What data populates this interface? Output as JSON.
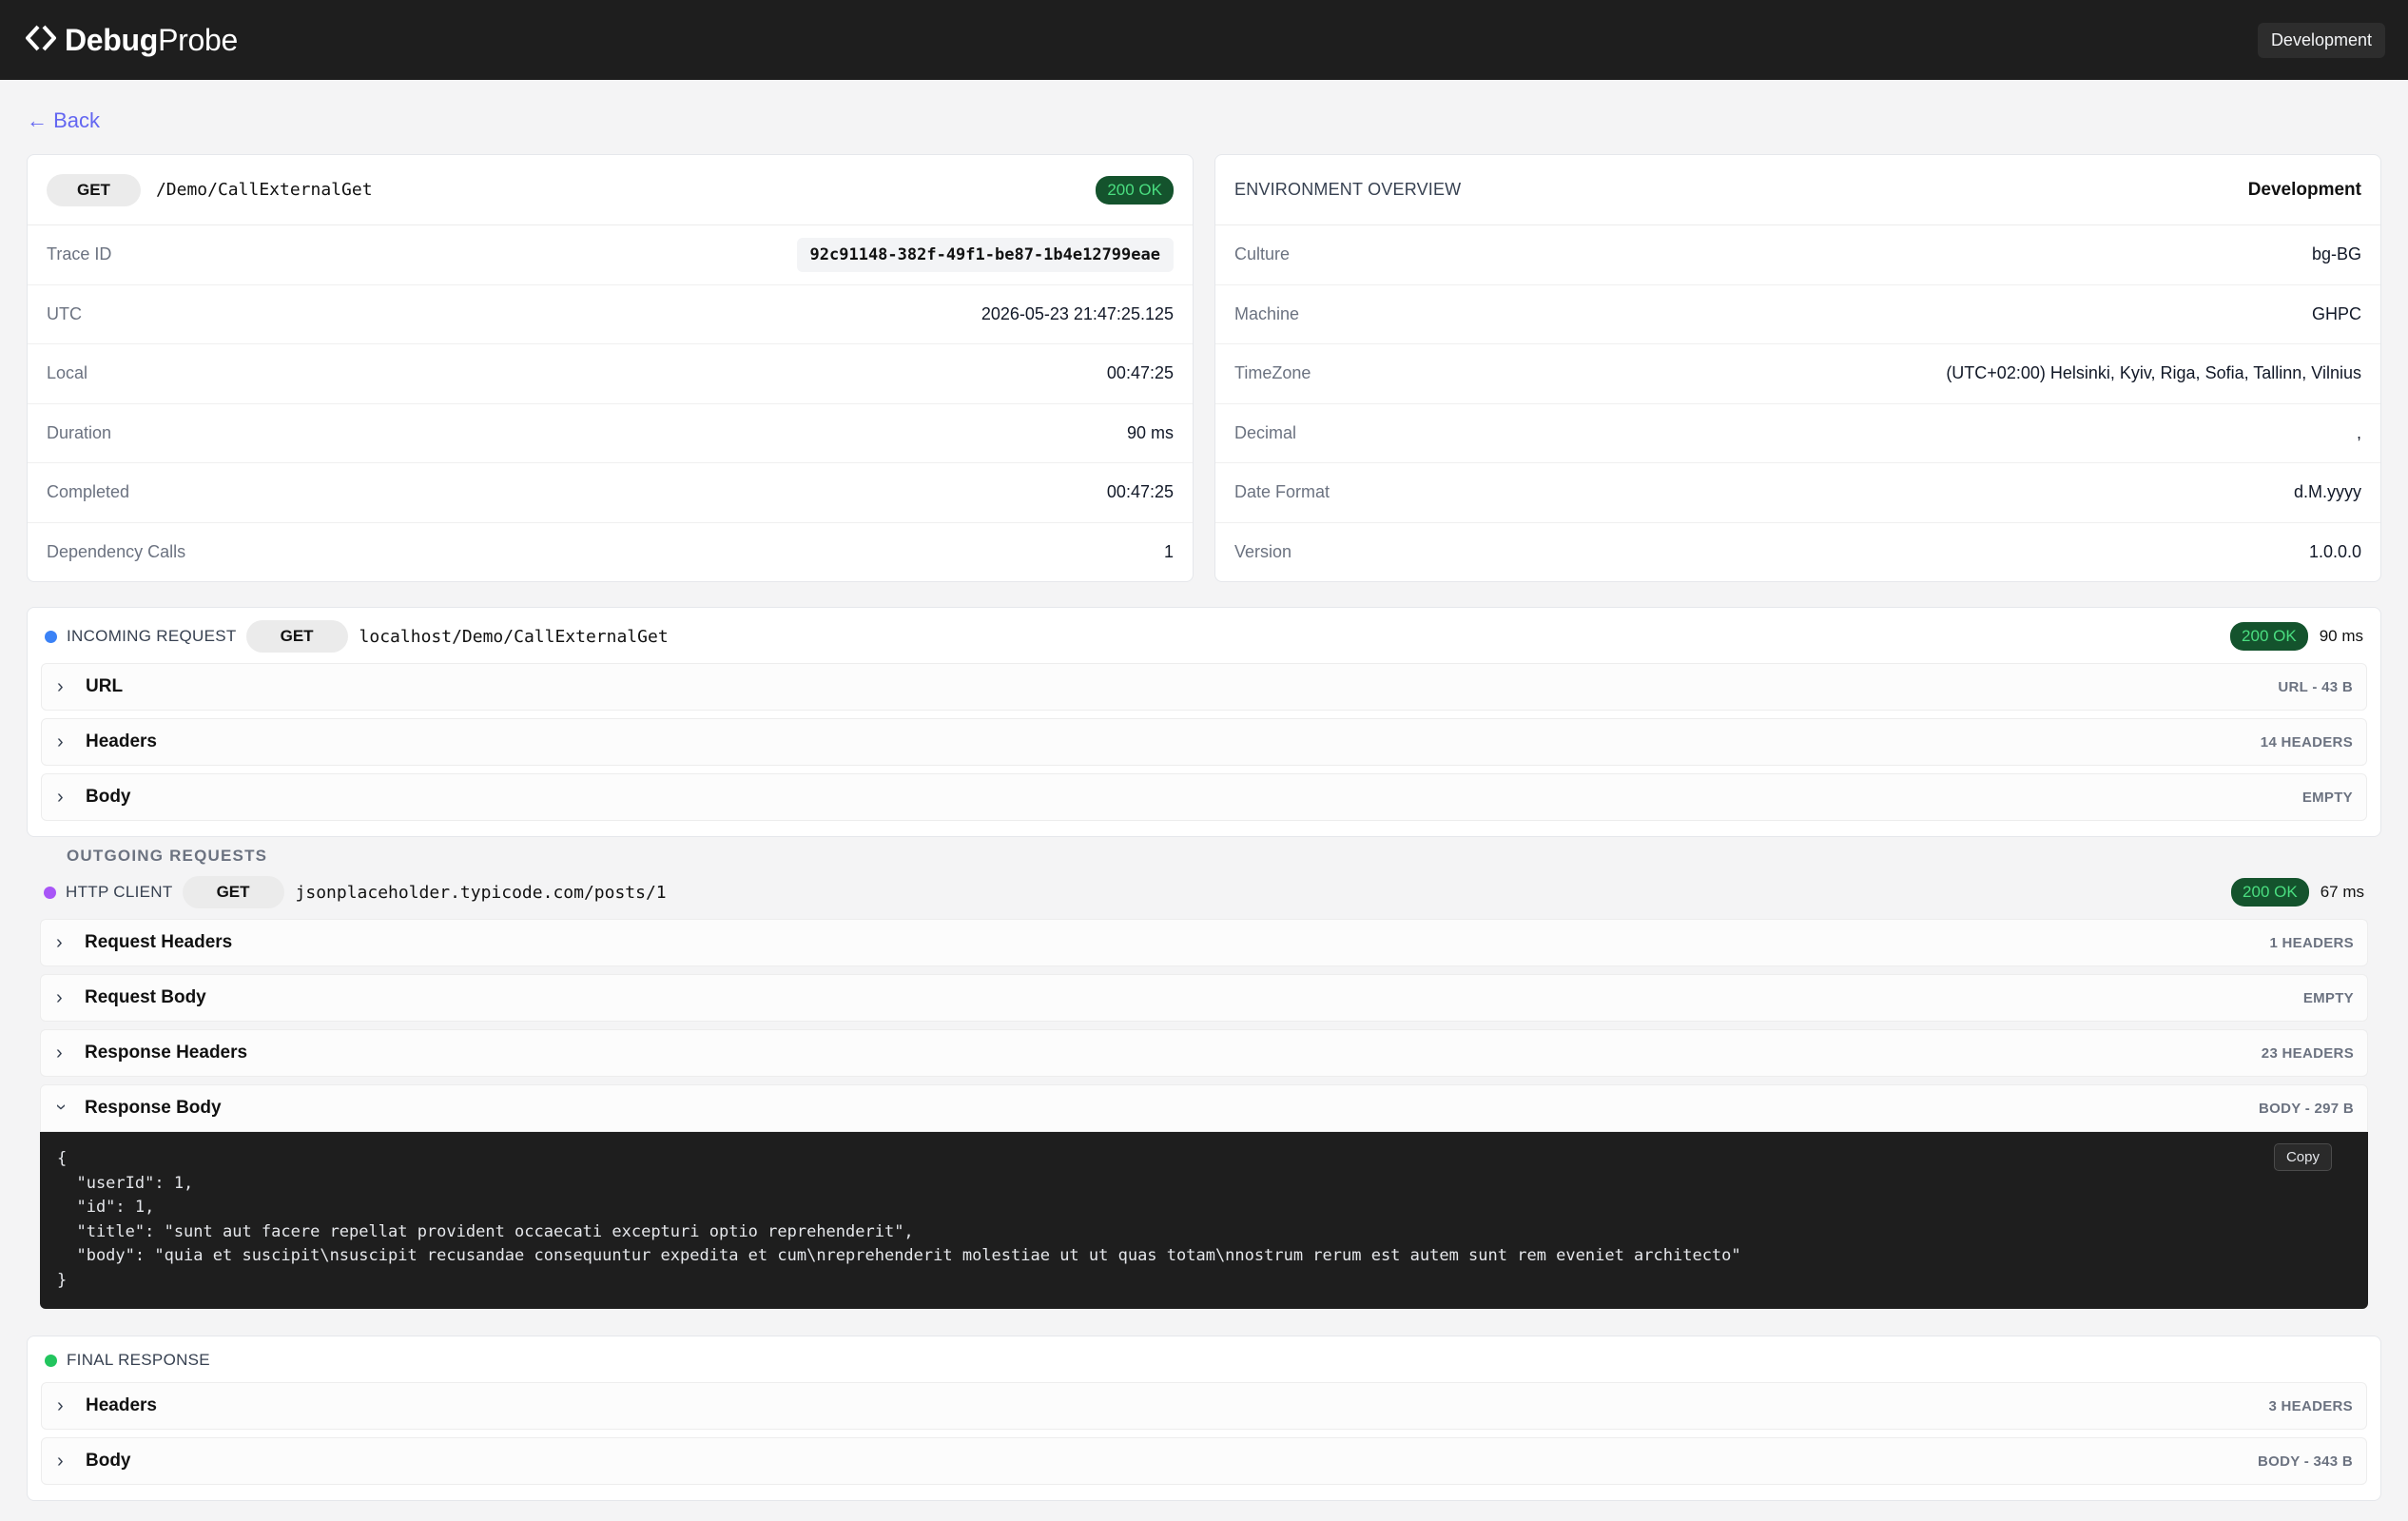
{
  "app": {
    "brand_bold": "Debug",
    "brand_light": "Probe",
    "environment": "Development"
  },
  "nav": {
    "back_label": "← Back"
  },
  "summary": {
    "method": "GET",
    "path": "/Demo/CallExternalGet",
    "status": "200 OK",
    "rows": [
      {
        "key": "Trace ID",
        "value": "92c91148-382f-49f1-be87-1b4e12799eae"
      },
      {
        "key": "UTC",
        "value": "2026-05-23 21:47:25.125"
      },
      {
        "key": "Local",
        "value": "00:47:25"
      },
      {
        "key": "Duration",
        "value": "90 ms"
      },
      {
        "key": "Completed",
        "value": "00:47:25"
      },
      {
        "key": "Dependency Calls",
        "value": "1"
      }
    ]
  },
  "environment": {
    "title": "ENVIRONMENT OVERVIEW",
    "name": "Development",
    "rows": [
      {
        "key": "Culture",
        "value": "bg-BG"
      },
      {
        "key": "Machine",
        "value": "GHPC"
      },
      {
        "key": "TimeZone",
        "value": "(UTC+02:00) Helsinki, Kyiv, Riga, Sofia, Tallinn, Vilnius"
      },
      {
        "key": "Decimal",
        "value": ","
      },
      {
        "key": "Date Format",
        "value": "d.M.yyyy"
      },
      {
        "key": "Version",
        "value": "1.0.0.0"
      }
    ]
  },
  "incoming": {
    "label": "INCOMING REQUEST",
    "method": "GET",
    "path": "localhost/Demo/CallExternalGet",
    "status": "200 OK",
    "duration": "90 ms",
    "dot_color": "#3b82f6",
    "sections": [
      {
        "title": "URL",
        "meta": "URL - 43 B"
      },
      {
        "title": "Headers",
        "meta": "14 HEADERS"
      },
      {
        "title": "Body",
        "meta": "EMPTY"
      }
    ]
  },
  "outgoing": {
    "heading": "OUTGOING REQUESTS",
    "label": "HTTP CLIENT",
    "method": "GET",
    "path": "jsonplaceholder.typicode.com/posts/1",
    "status": "200 OK",
    "duration": "67 ms",
    "dot_color": "#a855f7",
    "sections": [
      {
        "title": "Request Headers",
        "meta": "1 HEADERS"
      },
      {
        "title": "Request Body",
        "meta": "EMPTY"
      },
      {
        "title": "Response Headers",
        "meta": "23 HEADERS"
      },
      {
        "title": "Response Body",
        "meta": "BODY - 297 B"
      }
    ],
    "copy_label": "Copy",
    "response_body": "{\n  \"userId\": 1,\n  \"id\": 1,\n  \"title\": \"sunt aut facere repellat provident occaecati excepturi optio reprehenderit\",\n  \"body\": \"quia et suscipit\\nsuscipit recusandae consequuntur expedita et cum\\nreprehenderit molestiae ut ut quas totam\\nnostrum rerum est autem sunt rem eveniet architecto\"\n}"
  },
  "final": {
    "label": "FINAL RESPONSE",
    "dot_color": "#22c55e",
    "sections": [
      {
        "title": "Headers",
        "meta": "3 HEADERS"
      },
      {
        "title": "Body",
        "meta": "BODY - 343 B"
      }
    ]
  }
}
